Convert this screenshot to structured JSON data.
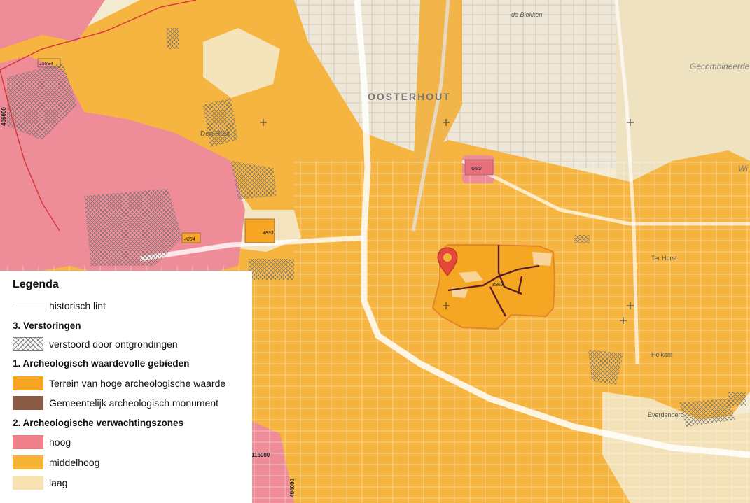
{
  "map": {
    "town_label": "OOSTERHOUT",
    "place_labels": [
      "de Blokken",
      "Gecombineerde",
      "Den Hout",
      "Heikant",
      "Ter Horst",
      "Wi",
      "Everdenberg"
    ],
    "monument_numbers": [
      "15994",
      "4882",
      "4893",
      "4884",
      "8869"
    ],
    "coord_labels": [
      "406000",
      "116000",
      "404000"
    ],
    "colors": {
      "high_value": "#f6a623",
      "monument": "#8a5a44",
      "hoog": "#ef7f8a",
      "middelhoog": "#f7b334",
      "laag": "#f8e2b2",
      "lint": "#222222"
    },
    "marker_icon": "location-pin-icon"
  },
  "legend": {
    "title": "Legenda",
    "line_label": "historisch lint",
    "section3_title": "3. Verstoringen",
    "verstoord_label": "verstoord door ontgrondingen",
    "section1_title": "1. Archeologisch waardevolle gebieden",
    "hoge_waarde_label": "Terrein van hoge archeologische waarde",
    "monument_label": "Gemeentelijk archeologisch monument",
    "section2_title": "2. Archeologische verwachtingszones",
    "hoog_label": "hoog",
    "middelhoog_label": "middelhoog",
    "laag_label": "laag"
  }
}
